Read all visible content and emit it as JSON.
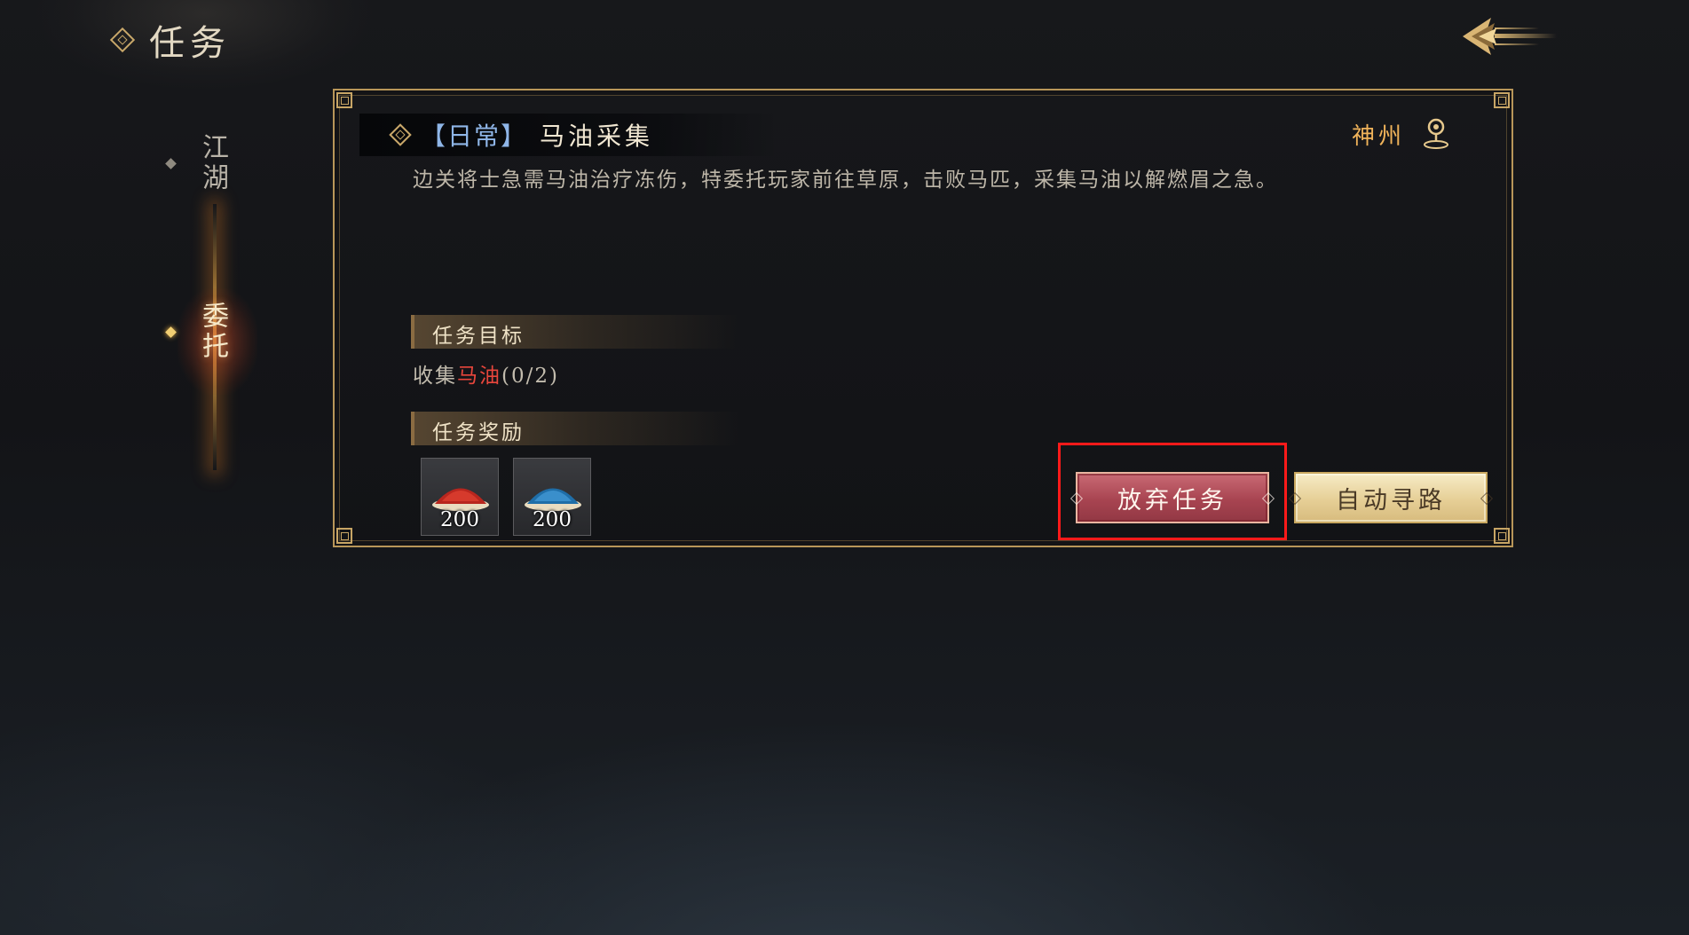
{
  "header": {
    "title": "任务",
    "back_icon": "back-arrow-icon"
  },
  "side_nav": {
    "items": [
      {
        "label": "江湖",
        "active": false
      },
      {
        "label": "委托",
        "active": true
      }
    ]
  },
  "task": {
    "category": "【日常】",
    "name": "马油采集",
    "location": "神州",
    "location_icon": "map-pin-icon",
    "description": "边关将士急需马油治疗冻伤，特委托玩家前往草原，击败马匹，采集马油以解燃眉之急。",
    "goal_header": "任务目标",
    "goal_prefix": "收集",
    "goal_item": "马油",
    "goal_progress": "(0/2)",
    "reward_header": "任务奖励",
    "rewards": [
      {
        "icon": "red-powder-pile-icon",
        "count": "200"
      },
      {
        "icon": "blue-powder-pile-icon",
        "count": "200"
      }
    ]
  },
  "buttons": {
    "abandon_label": "放弃任务",
    "auto_path_label": "自动寻路"
  },
  "colors": {
    "accent_gold": "#c9a86a",
    "goal_item_red": "#e8463c",
    "category_blue": "#8fb6e8",
    "location_orange": "#f0b35a",
    "highlight_red": "#ff1a1a"
  }
}
